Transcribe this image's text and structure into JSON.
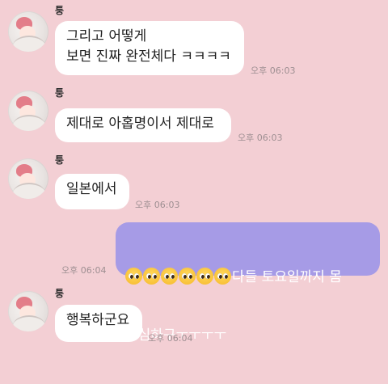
{
  "sender_name": "퉁",
  "messages": [
    {
      "from": "other",
      "text": "그리고 어떻게\n보면 진짜 완전체다 ㅋㅋㅋㅋ",
      "time": "오후 06:03"
    },
    {
      "from": "other",
      "text": "제대로 아홉명이서 제대로",
      "time": "오후 06:03"
    },
    {
      "from": "other",
      "text": "일본에서",
      "time": "오후 06:03"
    },
    {
      "from": "me",
      "emoji": "pleading-face-icon",
      "emoji_count": 6,
      "text_line1": "다들 토요일까지 몸",
      "text_line2": "조심하구ㅜㅜㅜㅜ",
      "time": "오후 06:04"
    },
    {
      "from": "other",
      "text": "행복하군요",
      "time": "오후 06:04"
    }
  ],
  "colors": {
    "background": "#f3cfd4",
    "bubble_other": "#ffffff",
    "bubble_mine": "#a69be6",
    "timestamp": "#9e8f92"
  }
}
